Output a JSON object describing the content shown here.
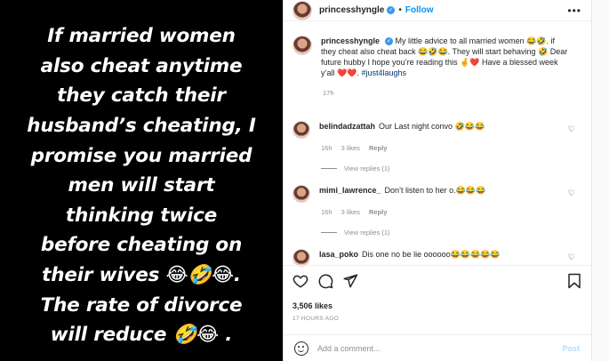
{
  "story": {
    "lines": [
      "If married women",
      "also  cheat anytime",
      "they catch their",
      "husband’s cheating, I",
      "promise you married",
      "men will start",
      "thinking twice",
      "before cheating on",
      "their wives 😂🤣😂.",
      "The rate of divorce",
      "will reduce 🤣😂 ."
    ]
  },
  "header": {
    "username": "princesshyngle",
    "separator": "•",
    "follow_label": "Follow",
    "more_label": "•••"
  },
  "caption": {
    "username": "princesshyngle",
    "text": "My little advice to all married women 😂🤣. if they cheat also cheat back 😂🤣😂. They will start behaving 🤣 Dear future hubby I hope you’re reading this 🤞❤️ Have a blessed week y’all ❤️❤️.",
    "hashtag": "#just4laughs",
    "time": "17h"
  },
  "comments": [
    {
      "username": "belindadzattah",
      "text": "Our Last night convo 🤣😂😂",
      "time": "16h",
      "likes": "3 likes",
      "reply": "Reply",
      "view_replies": "View replies (1)"
    },
    {
      "username": "mimi_lawrence_",
      "text": "Don’t listen to her o.😂😂😂",
      "time": "16h",
      "likes": "3 likes",
      "reply": "Reply",
      "view_replies": "View replies (1)"
    },
    {
      "username": "lasa_poko",
      "text": "Dis one no be lie oooooo😂😂😂😂😂"
    }
  ],
  "engagement": {
    "likes": "3,506 likes",
    "time_ago": "17 HOURS AGO"
  },
  "add_comment": {
    "placeholder": "Add a comment...",
    "post_label": "Post"
  },
  "colors": {
    "accent": "#0095f6",
    "muted": "#8e8e8e",
    "story_bg": "#000000"
  }
}
